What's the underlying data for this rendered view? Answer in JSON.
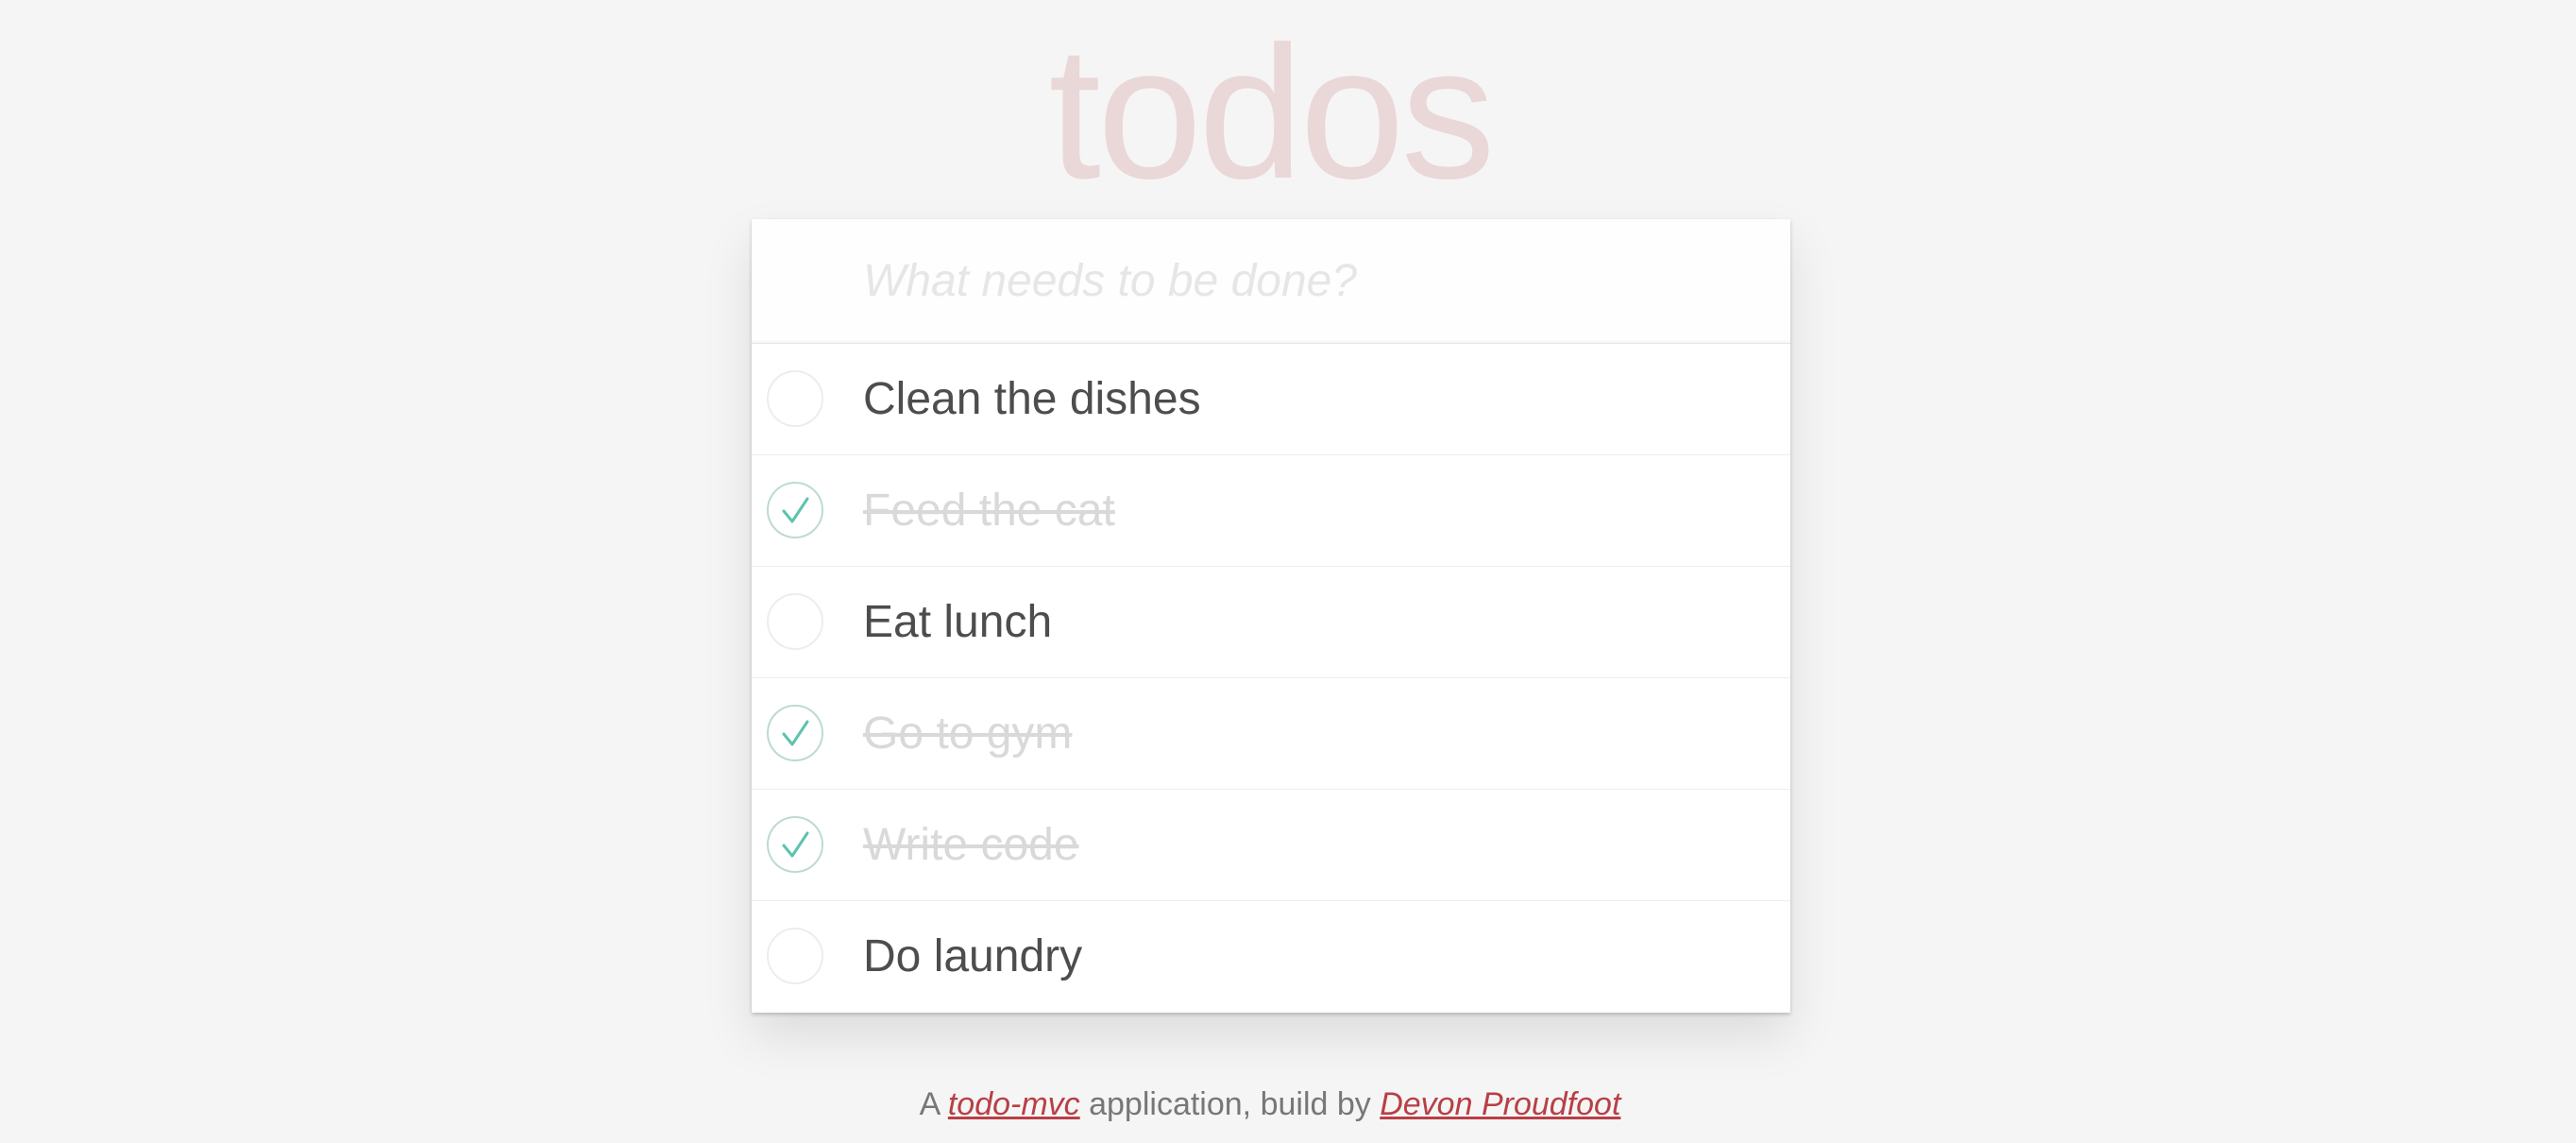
{
  "app": {
    "title": "todos"
  },
  "new_todo": {
    "placeholder": "What needs to be done?",
    "value": ""
  },
  "todos": [
    {
      "label": "Clean the dishes",
      "completed": false
    },
    {
      "label": "Feed the cat",
      "completed": true
    },
    {
      "label": "Eat lunch",
      "completed": false
    },
    {
      "label": "Go to gym",
      "completed": true
    },
    {
      "label": "Write code",
      "completed": true
    },
    {
      "label": "Do laundry",
      "completed": false
    }
  ],
  "footer": {
    "prefix": "A ",
    "todomvc_link": "todo-mvc",
    "middle": " application, build by ",
    "author_link": "Devon Proudfoot"
  },
  "colors": {
    "title": "#ead7d7",
    "check": "#5dc2af",
    "link": "#b83f45",
    "background": "#f5f5f5"
  },
  "icons": {
    "toggle_done": "check-icon"
  }
}
